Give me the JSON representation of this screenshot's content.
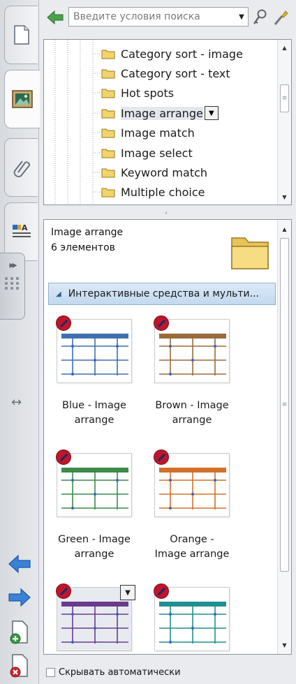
{
  "sidebar": {
    "tabs": [
      {
        "name": "page-sorter",
        "icon": "page-icon"
      },
      {
        "name": "gallery",
        "icon": "gallery-image-icon",
        "active": true
      },
      {
        "name": "attachments",
        "icon": "paperclip-icon"
      },
      {
        "name": "properties",
        "icon": "properties-icon"
      }
    ],
    "collapse_icon": "double-chevron-right-icon",
    "resize_icon": "horizontal-resize-icon",
    "back_icon": "arrow-left-icon",
    "forward_icon": "arrow-right-icon",
    "add_page_icon": "add-page-icon",
    "delete_page_icon": "delete-page-icon"
  },
  "search": {
    "placeholder": "Введите условия поиска",
    "back_icon": "green-back-arrow-icon",
    "search_icon": "search-key-icon",
    "tools_icon": "wrench-icon"
  },
  "tree": {
    "items": [
      {
        "label": "Category sort - image"
      },
      {
        "label": "Category sort - text"
      },
      {
        "label": "Hot spots"
      },
      {
        "label": "Image arrange",
        "selected": true
      },
      {
        "label": "Image match"
      },
      {
        "label": "Image select"
      },
      {
        "label": "Keyword match"
      },
      {
        "label": "Multiple choice"
      }
    ]
  },
  "gallery": {
    "title": "Image arrange",
    "count": "6 элементов",
    "category": "Интерактивные средства и мульти...",
    "items": [
      {
        "label_line1": "Blue - Image",
        "label_line2": "arrange",
        "accent": "#3f6fb0"
      },
      {
        "label_line1": "Brown - Image",
        "label_line2": "arrange",
        "accent": "#9a6a3a"
      },
      {
        "label_line1": "Green - Image",
        "label_line2": "arrange",
        "accent": "#3d8a4a"
      },
      {
        "label_line1": "Orange -",
        "label_line2": "Image arrange",
        "accent": "#d2702a"
      },
      {
        "label_line1": "",
        "label_line2": "",
        "accent": "#6a3a8c",
        "selected": true
      },
      {
        "label_line1": "",
        "label_line2": "",
        "accent": "#1f8f8f"
      }
    ]
  },
  "footer": {
    "autohide_label": "Скрывать автоматически",
    "autohide_checked": false
  },
  "colors": {
    "folder": "#f2d267",
    "category_bar": "#c9ddf1",
    "badge": "#c0152a"
  }
}
